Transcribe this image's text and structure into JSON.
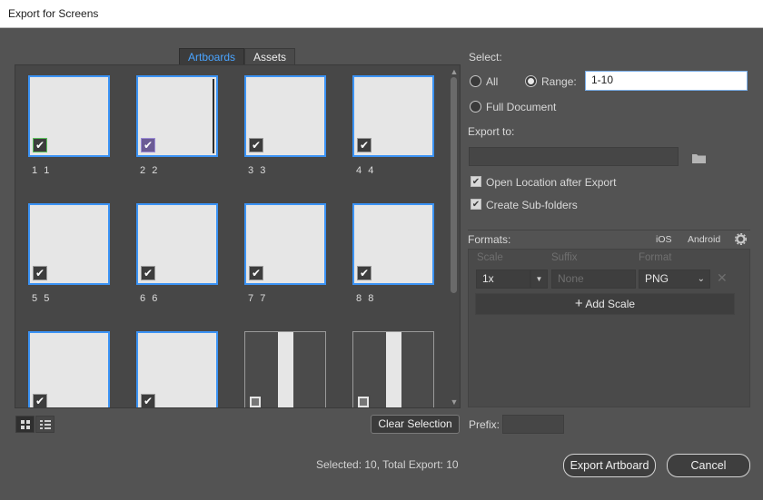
{
  "window": {
    "title": "Export for Screens"
  },
  "tabs": [
    {
      "label": "Artboards",
      "active": true
    },
    {
      "label": "Assets",
      "active": false
    }
  ],
  "artboards": [
    {
      "num": "1",
      "name": "1",
      "checked": true
    },
    {
      "num": "2",
      "name": "2",
      "checked": true
    },
    {
      "num": "3",
      "name": "3",
      "checked": true
    },
    {
      "num": "4",
      "name": "4",
      "checked": true
    },
    {
      "num": "5",
      "name": "5",
      "checked": true
    },
    {
      "num": "6",
      "name": "6",
      "checked": true
    },
    {
      "num": "7",
      "name": "7",
      "checked": true
    },
    {
      "num": "8",
      "name": "8",
      "checked": true
    },
    {
      "num": "",
      "name": "",
      "checked": true
    },
    {
      "num": "",
      "name": "",
      "checked": true
    },
    {
      "num": "",
      "name": "",
      "checked": false
    },
    {
      "num": "",
      "name": "",
      "checked": false
    }
  ],
  "clear_selection": "Clear Selection",
  "select": {
    "label": "Select:",
    "all": "All",
    "range": "Range:",
    "range_value": "1-10",
    "full_document": "Full Document",
    "selected_option": "range"
  },
  "export_to": {
    "label": "Export to:",
    "path": ""
  },
  "options": {
    "open_location": "Open Location after Export",
    "create_subfolders": "Create Sub-folders"
  },
  "formats": {
    "label": "Formats:",
    "ios": "iOS",
    "android": "Android",
    "headers": {
      "scale": "Scale",
      "suffix": "Suffix",
      "format": "Format"
    },
    "row": {
      "scale": "1x",
      "suffix_placeholder": "None",
      "format": "PNG"
    },
    "add_scale": "Add Scale"
  },
  "prefix": {
    "label": "Prefix:",
    "value": ""
  },
  "status": "Selected: 10, Total Export: 10",
  "buttons": {
    "export": "Export Artboard",
    "cancel": "Cancel"
  },
  "colors": {
    "accent": "#3b93f5",
    "background": "#535353"
  }
}
